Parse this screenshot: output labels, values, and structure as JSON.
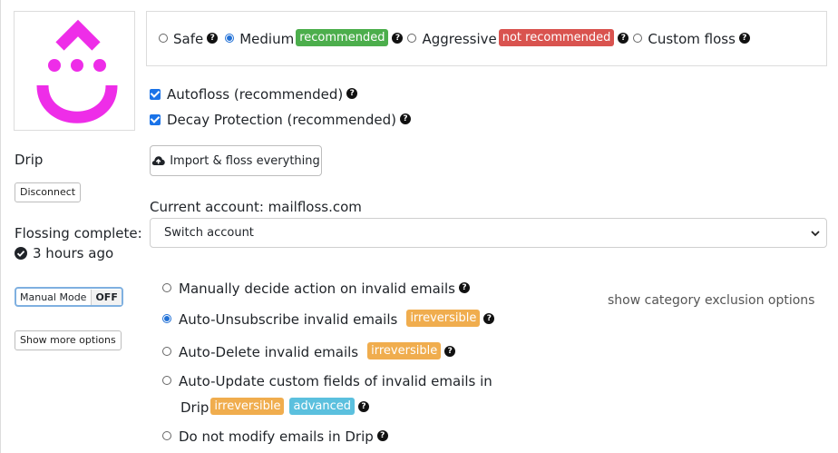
{
  "sidebar": {
    "service_name": "Drip",
    "disconnect_label": "Disconnect",
    "flossing_label": "Flossing complete:",
    "flossing_time": "3 hours ago",
    "manual_mode_label": "Manual Mode",
    "manual_mode_state": "OFF",
    "show_more_label": "Show more options",
    "logo_color": "#ee2de8"
  },
  "floss_levels": {
    "safe": "Safe",
    "medium": "Medium",
    "medium_badge": "recommended",
    "aggressive": "Aggressive",
    "aggressive_badge": "not recommended",
    "custom": "Custom floss",
    "selected": "Medium"
  },
  "checks": {
    "autofloss": "Autofloss (recommended)",
    "decay": "Decay Protection (recommended)"
  },
  "import_button": "Import & floss everything",
  "account": {
    "current_label": "Current account: mailfloss.com",
    "switch_label": "Switch account"
  },
  "invalid_actions": {
    "manual": "Manually decide action on invalid emails",
    "unsubscribe": "Auto-Unsubscribe invalid emails",
    "delete": "Auto-Delete invalid emails",
    "update_line1": "Auto-Update custom fields of invalid emails in",
    "update_line2": "Drip",
    "no_modify": "Do not modify emails in Drip",
    "irreversible": "irreversible",
    "advanced": "advanced",
    "selected": "Auto-Unsubscribe invalid emails"
  },
  "category_link": "show category exclusion options",
  "colors": {
    "green": "#4cae4c",
    "red": "#d9534f",
    "orange": "#f0ad4e",
    "blue": "#5bc0de",
    "accent": "#1a73e8"
  }
}
